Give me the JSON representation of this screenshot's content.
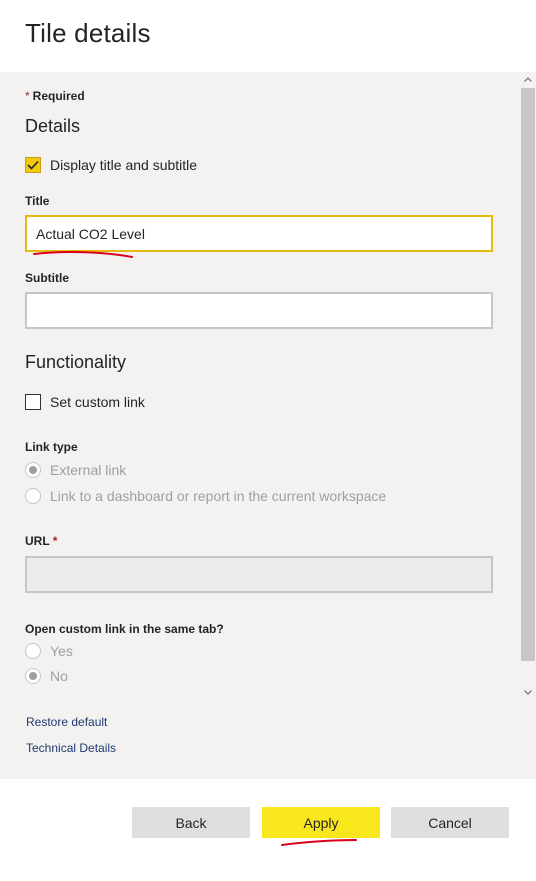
{
  "header": {
    "title": "Tile details"
  },
  "form": {
    "required_note": "Required",
    "required_star": "*",
    "details_heading": "Details",
    "display_title_label": "Display title and subtitle",
    "display_title_checked": true,
    "title_label": "Title",
    "title_value": "Actual CO2 Level",
    "subtitle_label": "Subtitle",
    "subtitle_value": "",
    "functionality_heading": "Functionality",
    "custom_link_label": "Set custom link",
    "custom_link_checked": false,
    "link_type_label": "Link type",
    "link_type_options": [
      "External link",
      "Link to a dashboard or report in the current workspace"
    ],
    "link_type_selected": "External link",
    "url_label": "URL",
    "url_value": "",
    "same_tab_label": "Open custom link in the same tab?",
    "same_tab_options": [
      "Yes",
      "No"
    ],
    "same_tab_selected": "No",
    "restore_default": "Restore default",
    "technical_details": "Technical Details"
  },
  "footer": {
    "back": "Back",
    "apply": "Apply",
    "cancel": "Cancel"
  },
  "colors": {
    "accent": "#f2c811",
    "apply_button": "#f8e71c",
    "annotation": "#d9001b",
    "link": "#1e3a72"
  }
}
